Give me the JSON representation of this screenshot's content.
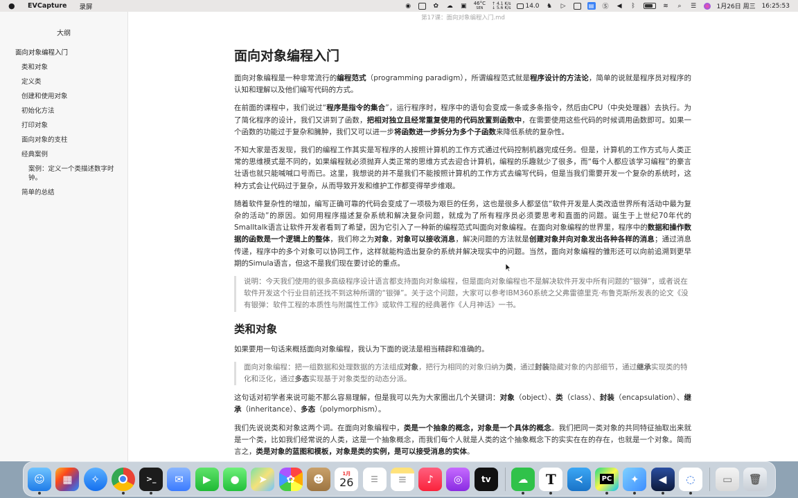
{
  "menubar": {
    "app_name": "EVCapture",
    "menu_item": "录屏",
    "temp_value": "46°C",
    "temp_label": "SEN",
    "net_up": "↑ 4.1 K/s",
    "net_down": "↓ 5.6 K/s",
    "cpu_value": "14.0",
    "date": "1月26日 周三",
    "time": "16:25:53"
  },
  "window": {
    "title": "第17课：面向对象编程入门.md"
  },
  "sidebar": {
    "title": "大纲",
    "items": [
      {
        "label": "面向对象编程入门",
        "level": 1
      },
      {
        "label": "类和对象",
        "level": 2
      },
      {
        "label": "定义类",
        "level": 2
      },
      {
        "label": "创建和使用对象",
        "level": 2
      },
      {
        "label": "初始化方法",
        "level": 2
      },
      {
        "label": "打印对象",
        "level": 2
      },
      {
        "label": "面向对象的支柱",
        "level": 2
      },
      {
        "label": "经典案例",
        "level": 2
      },
      {
        "label": "案例：定义一个类描述数字时钟。",
        "level": 3
      },
      {
        "label": "简单的总结",
        "level": 2
      }
    ]
  },
  "doc": {
    "h1": "面向对象编程入门",
    "p1": {
      "t1": "面向对象编程是一种非常流行的",
      "b1": "编程范式",
      "t2": "（programming paradigm），所谓编程范式就是",
      "b2": "程序设计的方法论",
      "t3": "，简单的说就是程序员对程序的认知和理解以及他们编写代码的方式。"
    },
    "p2": {
      "t1": "在前面的课程中，我们说过“",
      "b1": "程序是指令的集合",
      "t2": "”，运行程序时，程序中的语句会变成一条或多条指令，然后由CPU（中央处理器）去执行。为了简化程序的设计，我们又讲到了函数，",
      "b2": "把相对独立且经常重复使用的代码放置到函数中",
      "t3": "，在需要使用这些代码的时候调用函数即可。如果一个函数的功能过于复杂和臃肿，我们又可以进一步",
      "b3": "将函数进一步拆分为多个子函数",
      "t4": "来降低系统的复杂性。"
    },
    "p3": "不知大家是否发现，我们的编程工作其实是写程序的人按照计算机的工作方式通过代码控制机器完成任务。但是，计算机的工作方式与人类正常的思维模式是不同的，如果编程就必须抛弃人类正常的思维方式去迎合计算机，编程的乐趣就少了很多，而“每个人都应该学习编程”的豪言壮语也就只能喊喊口号而已。这里，我想说的并不是我们不能按照计算机的工作方式去编写代码，但是当我们需要开发一个复杂的系统时，这种方式会让代码过于复杂，从而导致开发和维护工作都变得举步维艰。",
    "p4": {
      "t1": "随着软件复杂性的增加，编写正确可靠的代码会变成了一项极为艰巨的任务，这也是很多人都坚信“软件开发是人类改造世界所有活动中最为复杂的活动”的原因。如何用程序描述复杂系统和解决复杂问题，就成为了所有程序员必须要思考和直面的问题。诞生于上世纪70年代的Smalltalk语言让软件开发者看到了希望，因为它引入了一种新的编程范式叫面向对象编程。在面向对象编程的世界里，程序中的",
      "b1": "数据和操作数据的函数是一个逻辑上的整体",
      "t2": "，我们称之为",
      "b2": "对象",
      "t3": "，",
      "b3": "对象可以接收消息",
      "t4": "，解决问题的方法就是",
      "b4": "创建对象并向对象发出各种各样的消息",
      "t5": "；通过消息传递，程序中的多个对象可以协同工作，这样就能构造出复杂的系统并解决现实中的问题。当然，面向对象编程的雏形还可以向前追溯到更早期的Simula语言，但这不是我们现在要讨论的重点。"
    },
    "quote1": "说明：今天我们使用的很多高级程序设计语言都支持面向对象编程，但是面向对象编程也不是解决软件开发中所有问题的“银弹”，或者说在软件开发这个行业目前还找不到这种所谓的“银弹”。关于这个问题，大家可以参考IBM360系统之父弗雷德里克·布鲁克斯所发表的论文《没有银弹：软件工程的本质性与附属性工作》或软件工程的经典著作《人月神话》一书。",
    "h2": "类和对象",
    "p5": "如果要用一句话来概括面向对象编程，我认为下面的说法是相当精辟和准确的。",
    "quote2": {
      "t1": "面向对象编程：把一组数据和处理数据的方法组成",
      "b1": "对象",
      "t2": "，把行为相同的对象归纳为",
      "b2": "类",
      "t3": "，通过",
      "b3": "封装",
      "t4": "隐藏对象的内部细节，通过",
      "b4": "继承",
      "t5": "实现类的特化和泛化，通过",
      "b5": "多态",
      "t6": "实现基于对象类型的动态分派。"
    },
    "p6": {
      "t1": "这句话对初学者来说可能不那么容易理解，但是我可以先为大家圈出几个关键词：",
      "b1": "对象",
      "t2": "（object）、",
      "b2": "类",
      "t3": "（class）、",
      "b3": "封装",
      "t4": "（encapsulation）、",
      "b4": "继承",
      "t5": "（inheritance）、",
      "b5": "多态",
      "t6": "（polymorphism）。"
    },
    "p7": {
      "t1": "我们先说说类和对象这两个词。在面向对象编程中，",
      "b1": "类是一个抽象的概念，对象是一个具体的概念",
      "t2": "。我们把同一类对象的共同特征抽取出来就是一个类，比如我们经常说的人类，这是一个抽象概念，而我们每个人就是人类的这个抽象概念下的实实在在的存在，也就是一个对象。简而言之，",
      "b2": "类是对象的蓝图和模板，对象是类的实例，是可以接受消息的实体",
      "t3": "。"
    }
  },
  "dock": {
    "calendar_month": "1月",
    "calendar_day": "26",
    "typora_letter": "T",
    "pycharm_letter": "PC",
    "tv_label": "tv"
  }
}
